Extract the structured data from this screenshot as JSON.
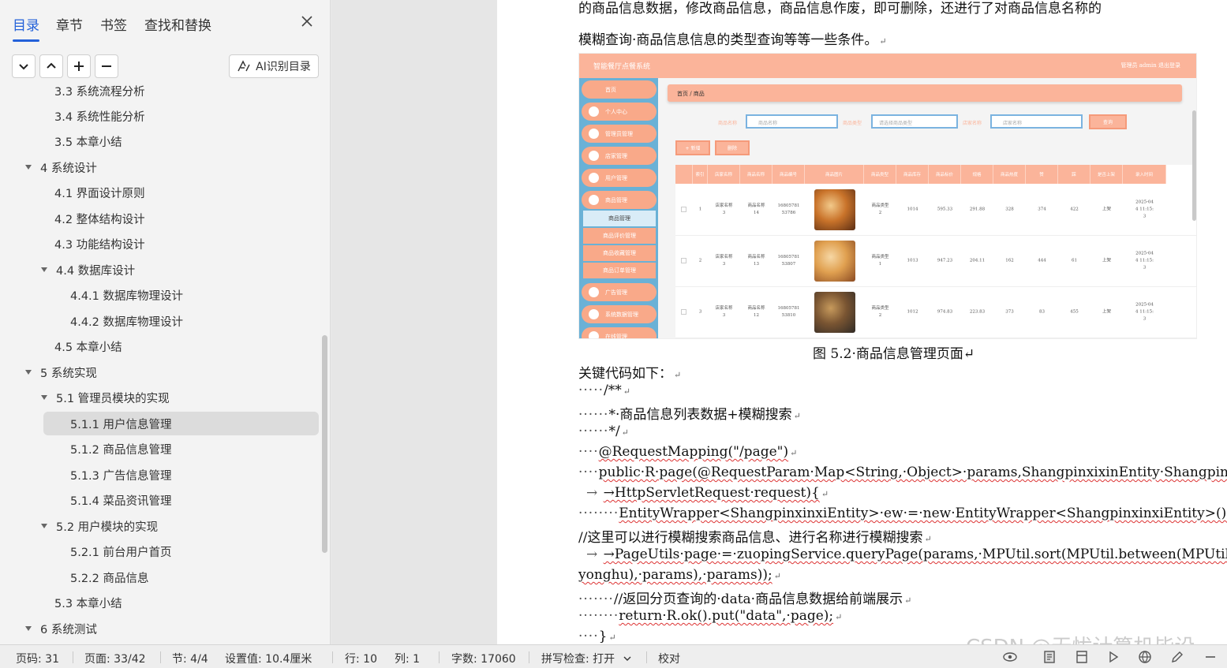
{
  "nav": {
    "tabs": [
      {
        "label": "目录"
      },
      {
        "label": "章节"
      },
      {
        "label": "书签"
      },
      {
        "label": "查找和替换"
      }
    ],
    "ai_button_label": "AI识别目录",
    "toc": [
      {
        "label": "3.3 系统流程分析"
      },
      {
        "label": "3.4 系统性能分析"
      },
      {
        "label": "3.5  本章小结"
      },
      {
        "label": "4 系统设计"
      },
      {
        "label": "4.1 界面设计原则"
      },
      {
        "label": "4.2 整体结构设计"
      },
      {
        "label": "4.3 功能结构设计"
      },
      {
        "label": "4.4 数据库设计"
      },
      {
        "label": "4.4.1   数据库物理设计"
      },
      {
        "label": "4.4.2   数据库物理设计"
      },
      {
        "label": "4.5  本章小结"
      },
      {
        "label": "5 系统实现"
      },
      {
        "label": "5.1  管理员模块的实现"
      },
      {
        "label": "5.1.1 用户信息管理"
      },
      {
        "label": "5.1.2 商品信息管理"
      },
      {
        "label": "5.1.3 广告信息管理"
      },
      {
        "label": "5.1.4 菜品资讯管理"
      },
      {
        "label": "5.2  用户模块的实现"
      },
      {
        "label": "5.2.1 前台用户首页"
      },
      {
        "label": "5.2.2  商品信息"
      },
      {
        "label": "5.3  本章小结"
      },
      {
        "label": "6 系统测试"
      }
    ]
  },
  "doc": {
    "intro_line1": "的商品信息数据，修改商品信息，商品信息作废，即可删除，还进行了对商品信息名称的",
    "intro_line2": "模糊查询·商品信息信息的类型查询等等一些条件。",
    "caption": "图 5.2·商品信息管理页面",
    "key_code_label": "关键代码如下：",
    "code": [
      {
        "dots": "·····",
        "text": "/**"
      },
      {
        "dots": "······",
        "text": "*·商品信息列表数据+模糊搜索"
      },
      {
        "dots": "······",
        "text": "*/"
      },
      {
        "dots": "····",
        "text": "@RequestMapping(\"/page\")"
      },
      {
        "dots": "····",
        "text": "public·R·page(@RequestParam·Map<String,·Object>·params,ShangpinxixinEntity·Shangpinxinxi,"
      },
      {
        "dots": " → ",
        "text": "→HttpServletRequest·request){"
      },
      {
        "dots": "········",
        "text": "EntityWrapper<ShangpinxinxiEntity>·ew·=·new·EntityWrapper<ShangpinxinxiEntity>();"
      },
      {
        "dots": "        ",
        "text": "//这里可以进行模糊搜索商品信息、进行名称进行模糊搜索"
      },
      {
        "dots": " → ",
        "text": "→PageUtils·page·=·zuopingService.queryPage(params,·MPUtil.sort(MPUtil.between(MPUtil.likeOrEq(ew,·"
      },
      {
        "dots": "",
        "text": "yonghu),·params),·params));"
      },
      {
        "dots": "·······",
        "text": "//返回分页查询的·data·商品信息数据给前端展示"
      },
      {
        "dots": "········",
        "text": "return·R.ok().put(\"data\",·page);"
      },
      {
        "dots": "····",
        "text": "}"
      }
    ]
  },
  "figure": {
    "title": "智能餐厅点餐系统",
    "user": "管理员 admin    退出登录",
    "menu": [
      "首页",
      "个人中心",
      "管理员管理",
      "店家管理",
      "用户管理",
      "商品管理",
      "广告管理",
      "系统数据管理",
      "在线管理"
    ],
    "submenu": [
      "商品管理",
      "商品评价管理",
      "商品收藏管理",
      "商品订单管理"
    ],
    "breadcrumb": "首页  /  商品",
    "search": [
      {
        "label": "商品名称",
        "placeholder": "商品名称"
      },
      {
        "label": "商品类型",
        "placeholder": "请选择商品类型"
      },
      {
        "label": "店家名称",
        "placeholder": "店家名称"
      }
    ],
    "search_button": "查询",
    "add_button": "+ 新增",
    "delete_button": "删除",
    "columns": [
      "",
      "索引",
      "店家名称",
      "商品名称",
      "商品编号",
      "商品图片",
      "商品类型",
      "商品库存",
      "商品标价",
      "规格",
      "商品热度",
      "赞",
      "踩",
      "是否上架",
      "录入时间"
    ],
    "rows": [
      [
        "",
        "1",
        "店家名称\n3",
        "商品名称\n14",
        "16805781\n53786",
        "",
        "商品类型\n2",
        "1014",
        "595.33",
        "291.88",
        "328",
        "374",
        "422",
        "上架",
        "2025-04\n4 11:15:\n3"
      ],
      [
        "",
        "2",
        "店家名称\n3",
        "商品名称\n13",
        "16805781\n53807",
        "",
        "商品类型\n1",
        "1013",
        "947.23",
        "204.11",
        "162",
        "444",
        "61",
        "上架",
        "2025-04\n4 11:15:\n3"
      ],
      [
        "",
        "3",
        "店家名称\n3",
        "商品名称\n12",
        "16805781\n53810",
        "",
        "商品类型\n2",
        "1012",
        "974.83",
        "223.83",
        "373",
        "83",
        "455",
        "上架",
        "2025-04\n4 11:15:\n3"
      ]
    ]
  },
  "status": {
    "page_no": "页码: 31",
    "pages": "页面: 33/42",
    "section": "节: 4/4",
    "setting": "设置值: 10.4厘米",
    "line": "行: 10",
    "col": "列: 1",
    "words": "字数: 17060",
    "spell": "拼写检查: 打开",
    "proof": "校对"
  },
  "watermark": "CSDN @无忧计算机毕设",
  "colors": {
    "accent": "#2361d9",
    "figure_header": "#fbb49a",
    "figure_sidebar": "#6ab1d6"
  }
}
